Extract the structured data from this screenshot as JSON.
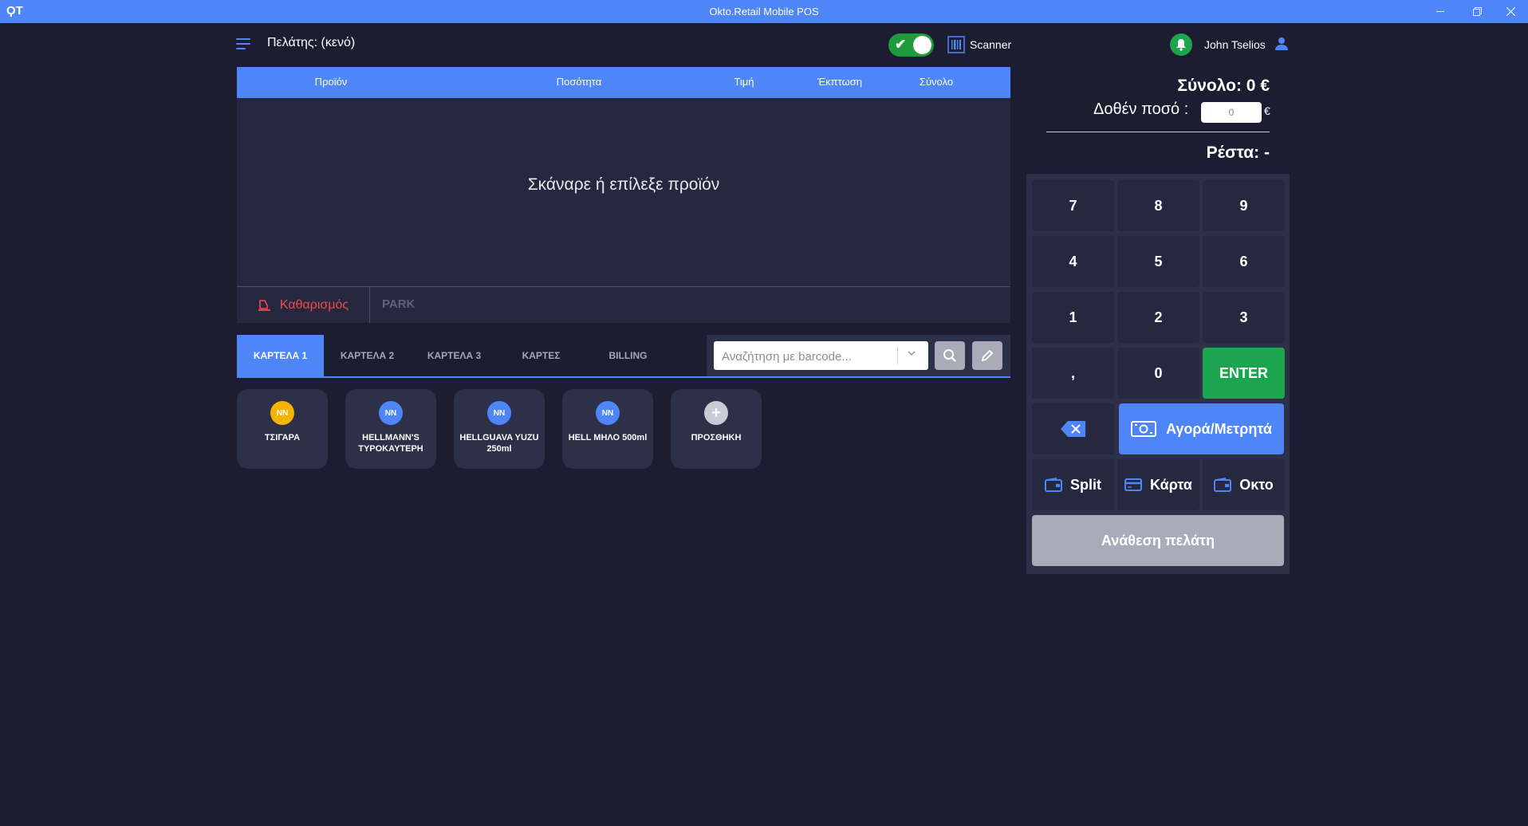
{
  "window": {
    "title": "Okto.Retail Mobile POS",
    "logo_text": "ϘΤ"
  },
  "header": {
    "customer_label": "Πελάτης: (κενό)",
    "scanner_label": "Scanner",
    "user_name": "John Tselios"
  },
  "cart": {
    "columns": [
      "Προϊόν",
      "Ποσότητα",
      "Τιμή",
      "Έκπτωση",
      "Σύνολο"
    ],
    "empty_message": "Σκάναρε ή επίλεξε προϊόν",
    "clear_label": "Καθαρισμός",
    "park_label": "PARK"
  },
  "tabs": {
    "items": [
      "ΚΑΡΤΕΛΑ 1",
      "ΚΑΡΤΕΛΑ 2",
      "ΚΑΡΤΕΛΑ 3",
      "ΚΑΡΤΕΣ",
      "BILLING"
    ],
    "active": "ΚΑΡΤΕΛΑ 1",
    "search_placeholder": "Αναζήτηση με barcode..."
  },
  "products": [
    {
      "badge": "NN",
      "badge_color": "#f4b400",
      "name": "ΤΣΙΓΑΡΑ"
    },
    {
      "badge": "NN",
      "badge_color": "#4f86f7",
      "name": "HELLMANN'S ΤΥΡΟΚΑΥΤΕΡΗ"
    },
    {
      "badge": "NN",
      "badge_color": "#4f86f7",
      "name": "HELLGUAVA YUZU 250ml"
    },
    {
      "badge": "NN",
      "badge_color": "#4f86f7",
      "name": "HELL ΜΗΛΟ 500ml"
    },
    {
      "badge": "+",
      "badge_color": "#c8cad4",
      "name": "ΠΡΟΣΘΗΚΗ"
    }
  ],
  "summary": {
    "total_label": "Σύνολο: 0 €",
    "given_label": "Δοθέν ποσό :",
    "given_value": "0",
    "currency": "€",
    "change_label": "Ρέστα: -"
  },
  "keypad": {
    "digits": [
      "7",
      "8",
      "9",
      "4",
      "5",
      "6",
      "1",
      "2",
      "3",
      ",",
      "0"
    ],
    "enter_label": "ENTER",
    "pay_cash_label": "Αγορά/Μετρητά",
    "split_label": "Split",
    "card_label": "Κάρτα",
    "okto_label": "Οκτο",
    "assign_label": "Ανάθεση πελάτη"
  },
  "colors": {
    "accent": "#4f86f7",
    "background": "#1c1d30",
    "panel": "#25283f",
    "success": "#1aa54e",
    "danger": "#f24a4a"
  }
}
